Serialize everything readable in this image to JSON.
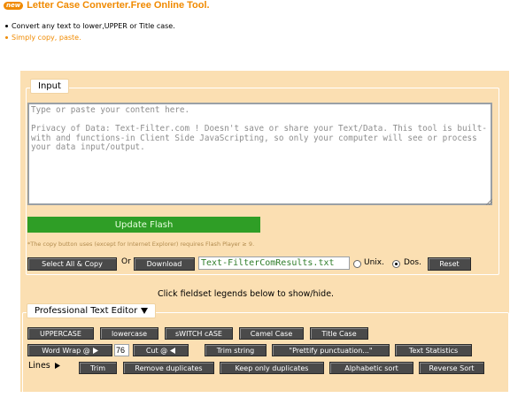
{
  "header": {
    "badge": "new",
    "title": "Letter Case Converter.Free Online Tool."
  },
  "bullets": [
    "Convert any text to lower,UPPER or Title case.",
    "Simply copy, paste."
  ],
  "input_section": {
    "legend": "Input",
    "textarea_text": "Type or paste your content here.\n\nPrivacy of Data: Text-Filter.com ! Doesn't save or share your Text/Data. This tool is built-with and functions-in Client Side JavaScripting, so only your computer will see or process your data input/output.",
    "update_flash_label": "Update Flash",
    "flash_note": "*The copy button uses (except for Internet Explorer) requires Flash Player ≥ 9.",
    "select_all_copy_label": "Select All & Copy",
    "or_label": "Or",
    "download_label": "Download",
    "filename_value": "Text-FilterComResults.txt",
    "unix_label": "Unix.",
    "dos_label": "Dos.",
    "line_ending_selected": "Dos.",
    "reset_label": "Reset"
  },
  "hint_text": "Click fieldset legends below to show/hide.",
  "editor": {
    "legend": "Professional Text Editor",
    "legend_icon": "triangle-down-icon",
    "case_buttons": [
      "UPPERCASE",
      "lowercase",
      "sWITCH cASE",
      "Camel Case",
      "Title Case"
    ],
    "word_wrap_label": "Word Wrap @",
    "word_wrap_icon": "triangle-right-icon",
    "word_wrap_value": "76",
    "cut_label": "Cut @",
    "cut_icon": "triangle-left-icon",
    "trim_string_label": "Trim string",
    "prettify_label": "\"Prettify punctuation...\"",
    "text_statistics_label": "Text Statistics",
    "lines_label": "Lines",
    "lines_icon": "triangle-right-icon",
    "line_buttons": [
      "Trim",
      "Remove duplicates",
      "Keep only duplicates",
      "Alphabetic sort",
      "Reverse Sort"
    ]
  },
  "colors": {
    "accent_orange": "#f08a00",
    "panel_bg": "#fbdfb2",
    "flash_green": "#2f9e26",
    "button_dark": "#4a4a4a"
  }
}
